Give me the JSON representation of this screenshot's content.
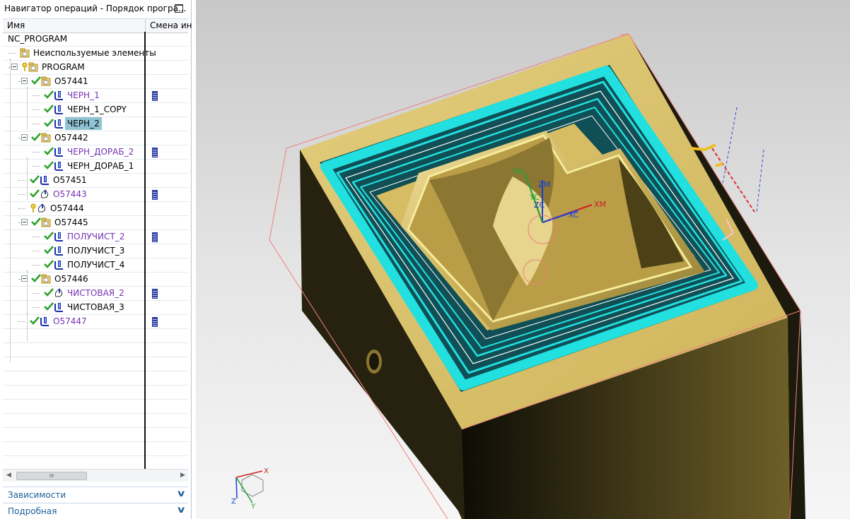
{
  "navigator": {
    "title": "Навигатор операций - Порядок програ...",
    "columns": {
      "name": "Имя",
      "tool_change": "Смена ин"
    },
    "rows": [
      {
        "label": "NC_PROGRAM",
        "indent": 0,
        "type": "root",
        "check": false,
        "toggle": false,
        "purple": false,
        "tool_change": false,
        "selected": false
      },
      {
        "label": "Неиспользуемые элементы",
        "indent": 1,
        "type": "group",
        "check": false,
        "toggle": false,
        "purple": false,
        "tool_change": false,
        "selected": false
      },
      {
        "label": "PROGRAM",
        "indent": 1,
        "type": "group-key",
        "check": false,
        "toggle": true,
        "purple": false,
        "tool_change": false,
        "selected": false
      },
      {
        "label": "O57441",
        "indent": 2,
        "type": "group",
        "check": true,
        "toggle": true,
        "purple": false,
        "tool_change": false,
        "selected": false
      },
      {
        "label": "ЧЕРН_1",
        "indent": 3,
        "type": "op",
        "check": true,
        "toggle": false,
        "purple": true,
        "tool_change": true,
        "selected": false
      },
      {
        "label": "ЧЕРН_1_COPY",
        "indent": 3,
        "type": "op",
        "check": true,
        "toggle": false,
        "purple": false,
        "tool_change": false,
        "selected": false
      },
      {
        "label": "ЧЕРН_2",
        "indent": 3,
        "type": "op",
        "check": true,
        "toggle": false,
        "purple": false,
        "tool_change": false,
        "selected": true
      },
      {
        "label": "O57442",
        "indent": 2,
        "type": "group",
        "check": true,
        "toggle": true,
        "purple": false,
        "tool_change": false,
        "selected": false
      },
      {
        "label": "ЧЕРН_ДОРАБ_2",
        "indent": 3,
        "type": "op",
        "check": true,
        "toggle": false,
        "purple": true,
        "tool_change": true,
        "selected": false
      },
      {
        "label": "ЧЕРН_ДОРАБ_1",
        "indent": 3,
        "type": "op",
        "check": true,
        "toggle": false,
        "purple": false,
        "tool_change": false,
        "selected": false
      },
      {
        "label": "O57451",
        "indent": 2,
        "type": "op",
        "check": true,
        "toggle": false,
        "purple": false,
        "tool_change": false,
        "selected": false
      },
      {
        "label": "O57443",
        "indent": 2,
        "type": "op-b",
        "check": true,
        "toggle": false,
        "purple": true,
        "tool_change": true,
        "selected": false
      },
      {
        "label": "O57444",
        "indent": 2,
        "type": "op-b",
        "check": false,
        "key": true,
        "toggle": false,
        "purple": false,
        "tool_change": false,
        "selected": false
      },
      {
        "label": "O57445",
        "indent": 2,
        "type": "group",
        "check": true,
        "toggle": true,
        "purple": false,
        "tool_change": false,
        "selected": false
      },
      {
        "label": "ПОЛУЧИСТ_2",
        "indent": 3,
        "type": "op",
        "check": true,
        "toggle": false,
        "purple": true,
        "tool_change": true,
        "selected": false
      },
      {
        "label": "ПОЛУЧИСТ_3",
        "indent": 3,
        "type": "op",
        "check": true,
        "toggle": false,
        "purple": false,
        "tool_change": false,
        "selected": false
      },
      {
        "label": "ПОЛУЧИСТ_4",
        "indent": 3,
        "type": "op",
        "check": true,
        "toggle": false,
        "purple": false,
        "tool_change": false,
        "selected": false
      },
      {
        "label": "O57446",
        "indent": 2,
        "type": "group",
        "check": true,
        "toggle": true,
        "purple": false,
        "tool_change": false,
        "selected": false
      },
      {
        "label": "ЧИСТОВАЯ_2",
        "indent": 3,
        "type": "op-b",
        "check": true,
        "toggle": false,
        "purple": true,
        "tool_change": true,
        "selected": false
      },
      {
        "label": "ЧИСТОВАЯ_3",
        "indent": 3,
        "type": "op",
        "check": true,
        "toggle": false,
        "purple": false,
        "tool_change": false,
        "selected": false
      },
      {
        "label": "O57447",
        "indent": 2,
        "type": "op",
        "check": true,
        "toggle": false,
        "purple": true,
        "tool_change": true,
        "selected": false
      }
    ],
    "scrollbar_grip": "III",
    "panels": [
      {
        "label": "Зависимости"
      },
      {
        "label": "Подробная"
      }
    ]
  },
  "viewport": {
    "wcs_labels": {
      "ym": "YM",
      "zm": "ZM",
      "xm": "XM",
      "yc": "YC",
      "zc": "ZC",
      "xc": "XC"
    },
    "triad_labels": {
      "x": "X",
      "y": "Y",
      "z": "Z"
    },
    "colors": {
      "part": "#d9c16a",
      "part_dark": "#2b2612",
      "toolpath": "#22e0e0",
      "background": "#d6d6d6"
    }
  }
}
